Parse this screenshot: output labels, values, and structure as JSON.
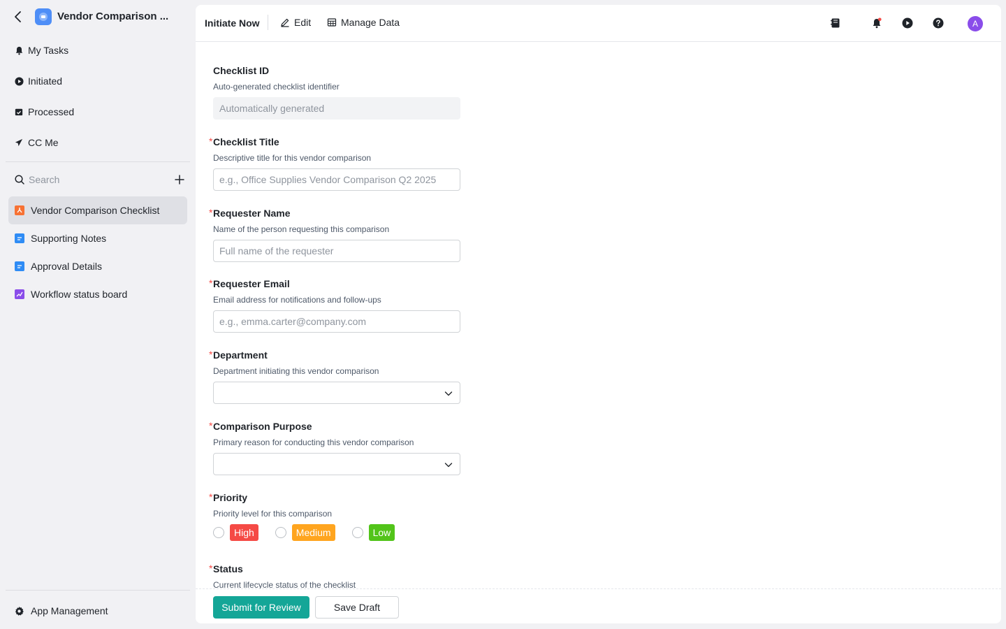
{
  "app": {
    "title": "Vendor Comparison ...",
    "back_icon": "chevron-left-icon",
    "logo_icon": "app-logo-icon",
    "logo_color": "#4e8ef7"
  },
  "sidebar": {
    "nav": [
      {
        "label": "My Tasks",
        "icon": "bell-icon"
      },
      {
        "label": "Initiated",
        "icon": "play-circle-icon"
      },
      {
        "label": "Processed",
        "icon": "calendar-check-icon"
      },
      {
        "label": "CC Me",
        "icon": "send-icon"
      }
    ],
    "search_placeholder": "Search",
    "pages": [
      {
        "label": "Vendor Comparison Checklist",
        "icon": "form-icon",
        "color": "#f77234",
        "active": true
      },
      {
        "label": "Supporting Notes",
        "icon": "doc-icon",
        "color": "#2f8cf5",
        "active": false
      },
      {
        "label": "Approval Details",
        "icon": "doc-icon",
        "color": "#2f8cf5",
        "active": false
      },
      {
        "label": "Workflow status board",
        "icon": "chart-icon",
        "color": "#8a4dea",
        "active": false
      }
    ],
    "app_management": "App Management"
  },
  "toolbar": {
    "initiate": "Initiate Now",
    "edit": "Edit",
    "manage_data": "Manage Data",
    "avatar_letter": "A"
  },
  "form": {
    "checklist_id": {
      "label": "Checklist ID",
      "desc": "Auto-generated checklist identifier",
      "placeholder": "Automatically generated"
    },
    "checklist_title": {
      "label": "Checklist Title",
      "desc": "Descriptive title for this vendor comparison",
      "placeholder": "e.g., Office Supplies Vendor Comparison Q2 2025"
    },
    "requester_name": {
      "label": "Requester Name",
      "desc": "Name of the person requesting this comparison",
      "placeholder": "Full name of the requester"
    },
    "requester_email": {
      "label": "Requester Email",
      "desc": "Email address for notifications and follow-ups",
      "placeholder": "e.g., emma.carter@company.com"
    },
    "department": {
      "label": "Department",
      "desc": "Department initiating this vendor comparison",
      "value": ""
    },
    "comparison_purpose": {
      "label": "Comparison Purpose",
      "desc": "Primary reason for conducting this vendor comparison",
      "value": ""
    },
    "priority": {
      "label": "Priority",
      "desc": "Priority level for this comparison",
      "options": [
        {
          "label": "High",
          "color": "#f54a45"
        },
        {
          "label": "Medium",
          "color": "#ffa51f"
        },
        {
          "label": "Low",
          "color": "#52c41a"
        }
      ]
    },
    "status": {
      "label": "Status",
      "desc": "Current lifecycle status of the checklist"
    },
    "required_mark": "*"
  },
  "footer": {
    "submit": "Submit for Review",
    "save_draft": "Save Draft"
  }
}
